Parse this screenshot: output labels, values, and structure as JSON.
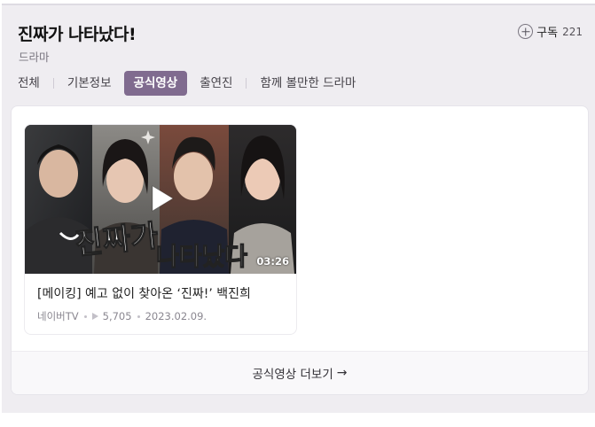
{
  "header": {
    "title": "진짜가 나타났다!",
    "subtitle": "드라마",
    "subscribe": {
      "icon": "plus-circle-icon",
      "label": "구독",
      "count": "221"
    }
  },
  "tabs": [
    {
      "label": "전체",
      "active": false
    },
    {
      "label": "기본정보",
      "active": false
    },
    {
      "label": "공식영상",
      "active": true
    },
    {
      "label": "출연진",
      "active": false
    },
    {
      "label": "함께 볼만한 드라마",
      "active": false
    }
  ],
  "videos": [
    {
      "thumbnail_text_line1": "진짜가",
      "thumbnail_text_line2": "나타났다",
      "duration": "03:26",
      "title": "[메이킹] 예고 없이 찾아온 ‘진짜!’ 백진희",
      "source": "네이버TV",
      "views": "5,705",
      "date": "2023.02.09."
    }
  ],
  "more": {
    "label": "공식영상 더보기",
    "icon": "arrow-right-icon"
  },
  "colors": {
    "panel_bg": "#efedf1",
    "active_tab_bg": "#806b8f",
    "card_bg": "#ffffff"
  }
}
